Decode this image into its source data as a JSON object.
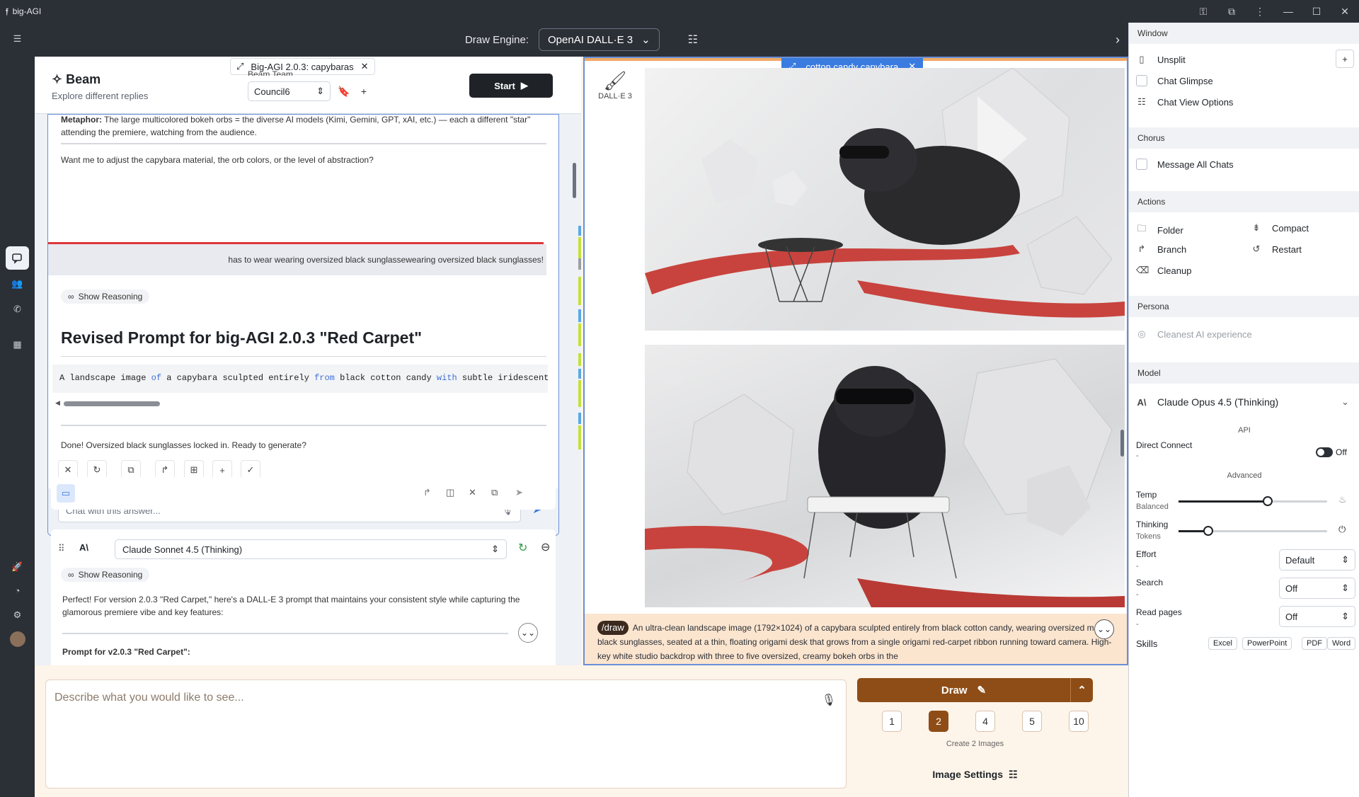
{
  "window": {
    "title": "big-AGI",
    "logo": "𝔣"
  },
  "topbar": {
    "engine_label": "Draw Engine:",
    "engine_value": "OpenAI DALL·E 3"
  },
  "beam": {
    "title": "Beam",
    "subtitle": "Explore different replies",
    "tab_label": "Big-AGI 2.0.3: capybaras",
    "team_label": "Beam Team",
    "team_value": "Council6",
    "start_label": "Start"
  },
  "answer": {
    "metaphor_label": "Metaphor:",
    "metaphor_text": "The large multicolored bokeh orbs = the diverse AI models (Kimi, Gemini, GPT, xAI, etc.) — each a different \"star\" attending the premiere, watching from the audience.",
    "question": "Want me to adjust the capybara material, the orb colors, or the level of abstraction?",
    "user_msg": "has to wear wearing oversized black sunglassewearing oversized black sunglasses!",
    "reasoning_label": "Show Reasoning",
    "heading": "Revised Prompt for big-AGI 2.0.3 \"Red Carpet\"",
    "done_text": "Done! Oversized black sunglasses locked in. Ready to generate?",
    "chat_placeholder": "Chat with this answer..."
  },
  "ray2": {
    "model": "Claude Sonnet 4.5 (Thinking)",
    "reasoning_label": "Show Reasoning",
    "text": "Perfect! For version 2.0.3 \"Red Carpet,\" here's a DALL-E 3 prompt that maintains your consistent style while capturing the glamorous premiere vibe and key features:",
    "subheading": "Prompt for v2.0.3 \"Red Carpet\":"
  },
  "images": {
    "tab_label": "cotton candy capybara",
    "engine_caption": "DALL·E 3",
    "prompt_tag": "/draw",
    "prompt_text": "An ultra-clean landscape image (1792×1024) of a capybara sculpted entirely from black cotton candy, wearing oversized matte-black sunglasses, seated at a thin, floating origami desk that grows from a single origami red-carpet ribbon running toward camera. High-key white studio backdrop with three to five oversized, creamy bokeh orbs in the"
  },
  "composer": {
    "placeholder": "Describe what you would like to see...",
    "draw_label": "Draw",
    "counts": [
      "1",
      "2",
      "4",
      "5",
      "10"
    ],
    "selected_count": "2",
    "create_caption": "Create 2 Images",
    "settings_label": "Image Settings"
  },
  "panel": {
    "window_head": "Window",
    "unsplit": "Unsplit",
    "glimpse": "Chat Glimpse",
    "view_options": "Chat View Options",
    "chorus_head": "Chorus",
    "message_all": "Message All Chats",
    "actions_head": "Actions",
    "folder": "Folder",
    "compact": "Compact",
    "branch": "Branch",
    "restart": "Restart",
    "cleanup": "Cleanup",
    "persona_head": "Persona",
    "persona": "Cleanest AI experience",
    "model_head": "Model",
    "model": "Claude Opus 4.5 (Thinking)",
    "api_label": "API",
    "direct_connect": "Direct Connect",
    "dash": "-",
    "off": "Off",
    "advanced_label": "Advanced",
    "temp": "Temp",
    "temp_sub": "Balanced",
    "temp_level": 0.6,
    "thinking": "Thinking",
    "thinking_sub": "Tokens",
    "thinking_level": 0.2,
    "effort": "Effort",
    "effort_value": "Default",
    "search": "Search",
    "search_value": "Off",
    "read_pages": "Read pages",
    "read_value": "Off",
    "skills": "Skills",
    "skill_list": [
      "Excel",
      "PowerPoint",
      "PDF",
      "Word"
    ]
  },
  "colors": {
    "accent": "#8e4d16",
    "highlight": "#3a7be0",
    "danger": "#e0363b",
    "minimap_blue": "#5aa9e6",
    "minimap_lime": "#c6e03a"
  }
}
